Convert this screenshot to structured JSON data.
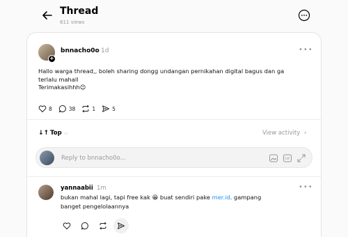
{
  "header": {
    "title": "Thread",
    "views": "611 views"
  },
  "post": {
    "username": "bnnacho0o",
    "time": "1d",
    "text_line1": "Hallo warga thread,, boleh sharing dongg undangan pernikahan digital bagus dan ga",
    "text_line2": "terlalu mahall",
    "text_line3": "Terimakasihhh",
    "text_emoji": "😊",
    "stats": {
      "likes": "8",
      "comments": "38",
      "reposts": "1",
      "shares": "5"
    }
  },
  "sort": {
    "label": "Top",
    "view_activity": "View activity"
  },
  "reply": {
    "placeholder": "Reply to bnnacho0o..."
  },
  "comment": {
    "username": "yannaabii",
    "time": "1m",
    "text_before": "bukan mahal lagi, tapi free kak ",
    "emoji": "😁",
    "text_middle": " buat sendiri pake ",
    "link": "mer.id",
    "text_after": ". gampang",
    "text_line2": "banget pengelolaannya"
  },
  "icons": {
    "back": "arrow-left-icon",
    "more": "more-circle-icon",
    "like": "heart-icon",
    "comment": "comment-icon",
    "repost": "repost-icon",
    "share": "send-icon",
    "image": "image-icon",
    "gif": "gif-icon",
    "expand": "expand-icon"
  },
  "colors": {
    "link": "#1d8ff0",
    "muted": "#999999",
    "background": "#fafafa"
  }
}
